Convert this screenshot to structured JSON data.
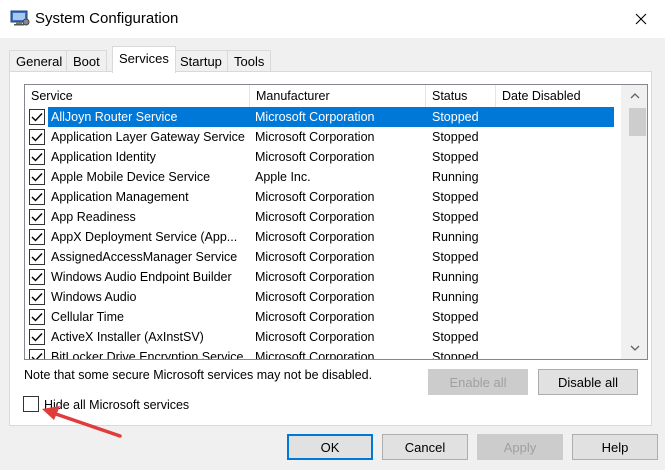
{
  "window": {
    "title": "System Configuration"
  },
  "tabs": [
    {
      "label": "General",
      "active": false
    },
    {
      "label": "Boot",
      "active": false
    },
    {
      "label": "Services",
      "active": true
    },
    {
      "label": "Startup",
      "active": false
    },
    {
      "label": "Tools",
      "active": false
    }
  ],
  "table": {
    "headers": {
      "service": "Service",
      "manufacturer": "Manufacturer",
      "status": "Status",
      "date_disabled": "Date Disabled"
    },
    "rows": [
      {
        "service": "AllJoyn Router Service",
        "manufacturer": "Microsoft Corporation",
        "status": "Stopped",
        "checked": true,
        "selected": true
      },
      {
        "service": "Application Layer Gateway Service",
        "manufacturer": "Microsoft Corporation",
        "status": "Stopped",
        "checked": true
      },
      {
        "service": "Application Identity",
        "manufacturer": "Microsoft Corporation",
        "status": "Stopped",
        "checked": true
      },
      {
        "service": "Apple Mobile Device Service",
        "manufacturer": "Apple Inc.",
        "status": "Running",
        "checked": true
      },
      {
        "service": "Application Management",
        "manufacturer": "Microsoft Corporation",
        "status": "Stopped",
        "checked": true
      },
      {
        "service": "App Readiness",
        "manufacturer": "Microsoft Corporation",
        "status": "Stopped",
        "checked": true
      },
      {
        "service": "AppX Deployment Service (App...",
        "manufacturer": "Microsoft Corporation",
        "status": "Running",
        "checked": true
      },
      {
        "service": "AssignedAccessManager Service",
        "manufacturer": "Microsoft Corporation",
        "status": "Stopped",
        "checked": true
      },
      {
        "service": "Windows Audio Endpoint Builder",
        "manufacturer": "Microsoft Corporation",
        "status": "Running",
        "checked": true
      },
      {
        "service": "Windows Audio",
        "manufacturer": "Microsoft Corporation",
        "status": "Running",
        "checked": true
      },
      {
        "service": "Cellular Time",
        "manufacturer": "Microsoft Corporation",
        "status": "Stopped",
        "checked": true
      },
      {
        "service": "ActiveX Installer (AxInstSV)",
        "manufacturer": "Microsoft Corporation",
        "status": "Stopped",
        "checked": true
      },
      {
        "service": "BitLocker Drive Encryption Service",
        "manufacturer": "Microsoft Corporation",
        "status": "Stopped",
        "checked": true
      }
    ]
  },
  "note": "Note that some secure Microsoft services may not be disabled.",
  "buttons": {
    "enable_all": "Enable all",
    "disable_all": "Disable all",
    "ok": "OK",
    "cancel": "Cancel",
    "apply": "Apply",
    "help": "Help"
  },
  "hide_ms": {
    "label": "Hide all Microsoft services",
    "checked": false
  },
  "colors": {
    "selection": "#0078d7",
    "annotation_arrow": "#e03c3c"
  }
}
